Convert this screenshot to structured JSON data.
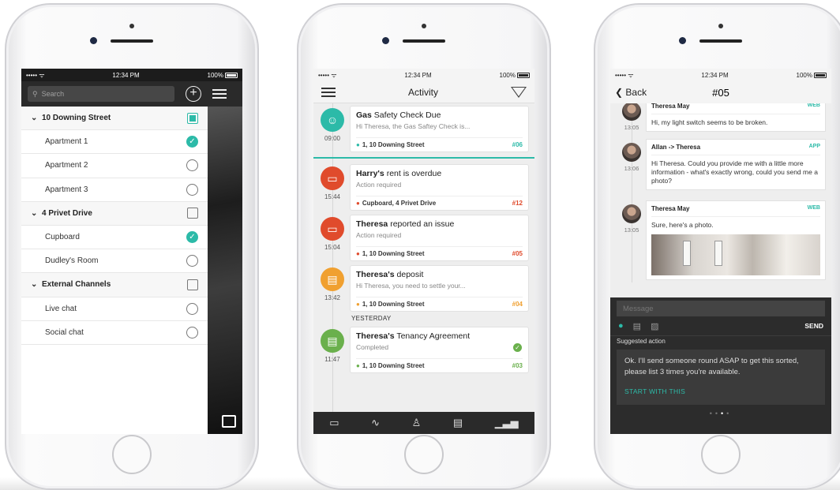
{
  "phone1": {
    "status": {
      "carrier": "••••• ᯤ",
      "time": "12:34 PM",
      "battery": "100%"
    },
    "search_placeholder": "Search",
    "groups": [
      {
        "name": "10 Downing Street",
        "checked": true,
        "items": [
          {
            "label": "Apartment 1",
            "selected": true
          },
          {
            "label": "Apartment 2",
            "selected": false
          },
          {
            "label": "Apartment 3",
            "selected": false
          }
        ]
      },
      {
        "name": "4 Privet Drive",
        "checked": false,
        "items": [
          {
            "label": "Cupboard",
            "selected": true
          },
          {
            "label": "Dudley's Room",
            "selected": false
          }
        ]
      },
      {
        "name": "External Channels",
        "checked": false,
        "items": [
          {
            "label": "Live chat",
            "selected": false
          },
          {
            "label": "Social chat",
            "selected": false
          }
        ]
      }
    ]
  },
  "phone2": {
    "status": {
      "carrier": "••••• ᯤ",
      "time": "12:34 PM",
      "battery": "100%"
    },
    "title": "Activity",
    "activities": [
      {
        "bold": "Gas",
        "rest": " Safety Check Due",
        "sub": "Hi Theresa, the Gas Saftey Check is...",
        "time": "09:00",
        "location": "1, 10 Downing Street",
        "ref": "#06",
        "ref_color": "#2cbaa8",
        "icon_color": "#2cbaa8",
        "icon": "☺"
      },
      {
        "bold": "Harry's",
        "rest": " rent is overdue",
        "sub": "Action required",
        "time": "15:44",
        "location": "Cupboard, 4 Privet Drive",
        "ref": "#12",
        "ref_color": "#e04b2c",
        "icon_color": "#e04b2c",
        "icon": "▭"
      },
      {
        "bold": "Theresa",
        "rest": " reported an issue",
        "sub": "Action required",
        "time": "15:04",
        "location": "1, 10 Downing Street",
        "ref": "#05",
        "ref_color": "#e04b2c",
        "icon_color": "#e04b2c",
        "icon": "▭"
      },
      {
        "bold": "Theresa's",
        "rest": " deposit",
        "sub": "Hi Theresa, you need to settle your...",
        "time": "13:42",
        "location": "1, 10 Downing Street",
        "ref": "#04",
        "ref_color": "#f0a030",
        "icon_color": "#f0a030",
        "icon": "▤"
      }
    ],
    "day_label": "YESTERDAY",
    "yesterday": {
      "bold": "Theresa's",
      "rest": " Tenancy Agreement",
      "sub": "Completed",
      "time": "11:47",
      "location": "1, 10 Downing Street",
      "ref": "#03",
      "ref_color": "#6ab04c",
      "icon_color": "#6ab04c",
      "icon": "▤"
    },
    "tabs": [
      "chat-icon",
      "activity-icon",
      "person-icon",
      "document-icon",
      "stats-icon"
    ]
  },
  "phone3": {
    "status": {
      "carrier": "••••• ᯤ",
      "time": "12:34 PM",
      "battery": "100%"
    },
    "back_label": "Back",
    "title": "#05",
    "messages": [
      {
        "sender": "Theresa May",
        "source": "WEB",
        "time": "13:05",
        "text": "Hi, my light switch seems to be broken."
      },
      {
        "sender": "Allan -> Theresa",
        "source": "APP",
        "time": "13:06",
        "text": "Hi Theresa. Could you provide me with a little more information - what's exactly wrong, could you send me a photo?"
      },
      {
        "sender": "Theresa May",
        "source": "WEB",
        "time": "13:05",
        "text": "Sure, here's a photo."
      }
    ],
    "message_placeholder": "Message",
    "send_label": "SEND",
    "suggested_heading": "Suggested action",
    "suggested_text": "Ok. I'll send someone round ASAP to get this sorted, please list 3 times you're available.",
    "suggested_cta": "START WITH THIS",
    "pager": {
      "count": 4,
      "active": 3
    }
  }
}
